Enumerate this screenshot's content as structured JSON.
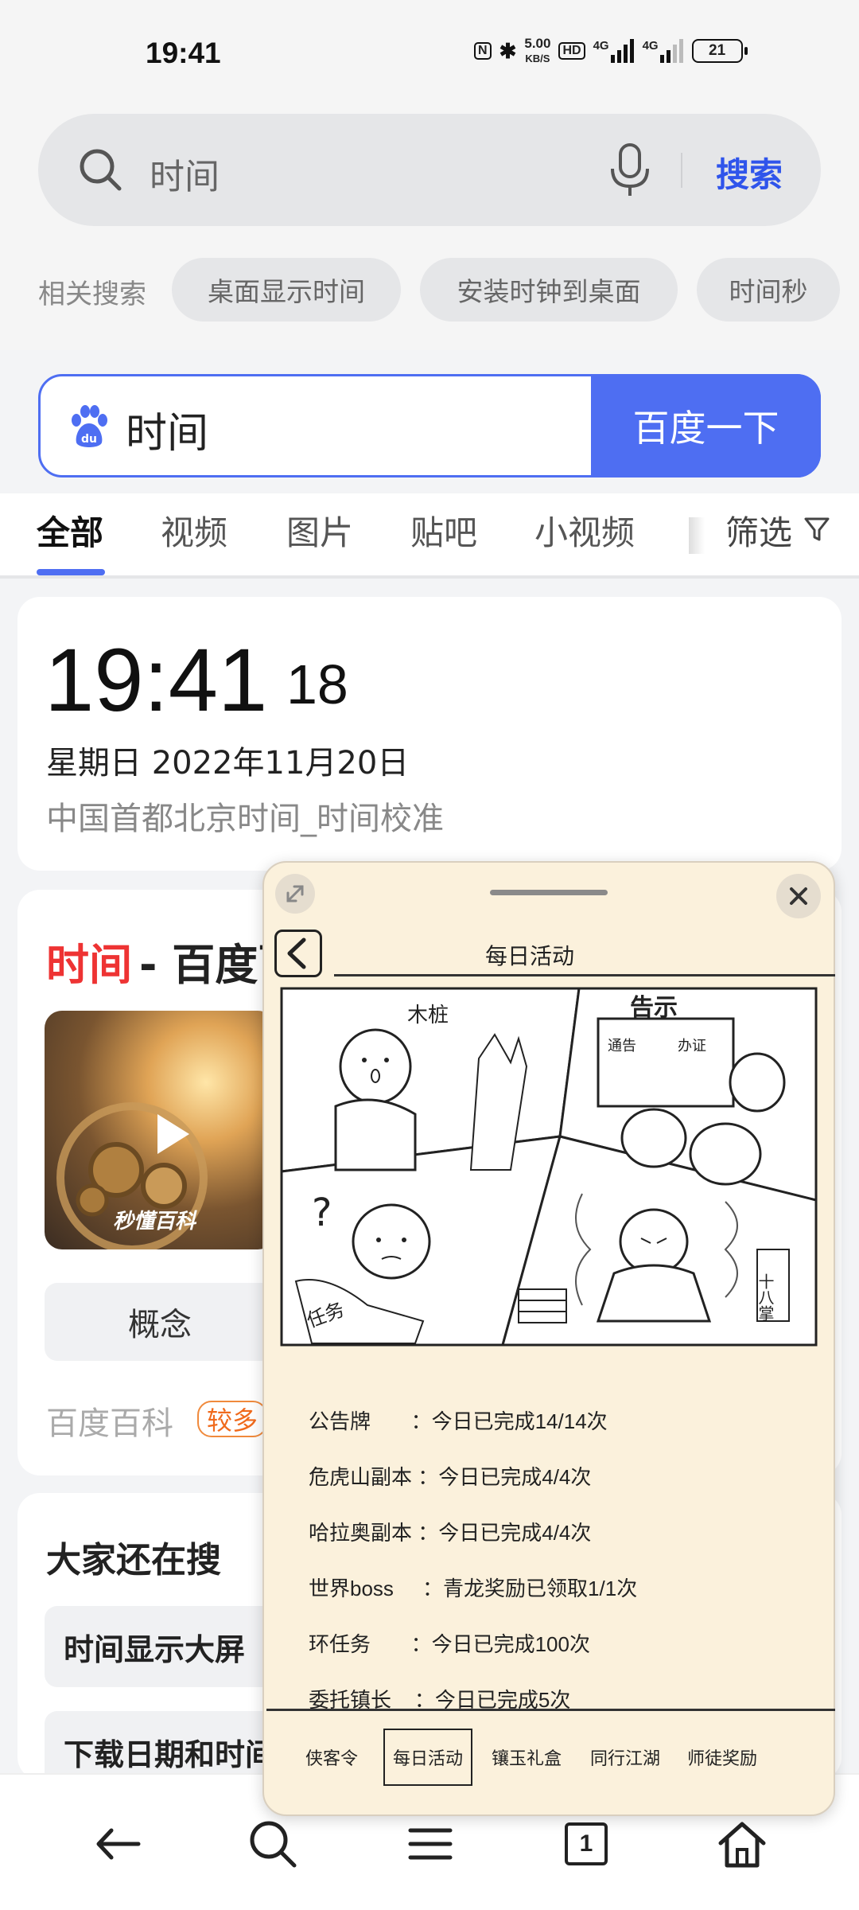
{
  "status_bar": {
    "time": "19:41",
    "nfc": "N",
    "bluetooth": "✱",
    "speed_value": "5.00",
    "speed_unit": "KB/S",
    "hd": "HD",
    "network_1": "4G",
    "network_2": "4G",
    "battery": "21"
  },
  "top_search": {
    "query": "时间",
    "button": "搜索"
  },
  "related": {
    "label": "相关搜索",
    "chips": [
      "桌面显示时间",
      "安装时钟到桌面",
      "时间秒"
    ]
  },
  "baidu": {
    "query": "时间",
    "button": "百度一下"
  },
  "tabs": {
    "items": [
      "全部",
      "视频",
      "图片",
      "贴吧",
      "小视频"
    ],
    "active": "全部",
    "filter": "筛选"
  },
  "time_card": {
    "time": "19:41",
    "seconds": "18",
    "date": "星期日  2022年11月20日",
    "subtitle": "中国首都北京时间_时间校准"
  },
  "baike_card": {
    "title_highlight": "时间",
    "title_rest": " - 百度百",
    "video_brand": "秒懂百科",
    "concept": "概念",
    "source": "百度百科",
    "badge": "较多"
  },
  "also_search": {
    "title": "大家还在搜",
    "items": [
      "时间显示大屏",
      "下载日期和时间"
    ]
  },
  "overlay": {
    "title": "每日活动",
    "comic_labels": {
      "stake": "木桩",
      "notice": "告示",
      "notice_left": "通告",
      "notice_right": "办证",
      "scroll": "任务",
      "scroll_right": "十八掌"
    },
    "records": [
      {
        "name": "公告牌",
        "sep": "       ：",
        "status": "今日已完成14/14次"
      },
      {
        "name": "危虎山副本",
        "sep": " ：",
        "status": "今日已完成4/4次"
      },
      {
        "name": "哈拉奥副本",
        "sep": " ：",
        "status": "今日已完成4/4次"
      },
      {
        "name": "世界boss",
        "sep": "     ：",
        "status": "青龙奖励已领取1/1次"
      },
      {
        "name": "环任务",
        "sep": "       ：",
        "status": "今日已完成100次"
      },
      {
        "name": "委托镇长",
        "sep": "    ：",
        "status": "今日已完成5次"
      }
    ],
    "tabs": [
      "侠客令",
      "每日活动",
      "镶玉礼盒",
      "同行江湖",
      "师徒奖励"
    ],
    "active_tab": "每日活动"
  },
  "bottom_nav": {
    "tab_count": "1"
  }
}
